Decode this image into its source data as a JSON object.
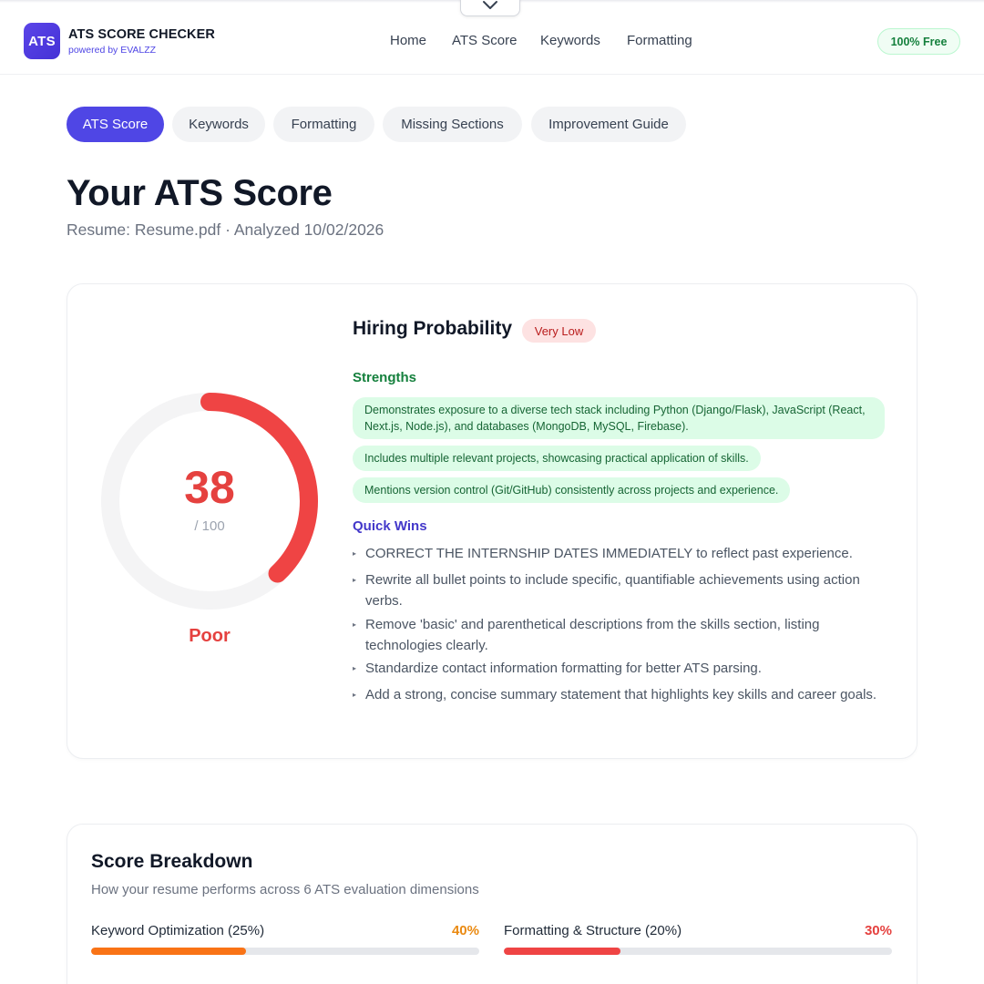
{
  "header": {
    "logo_text": "ATS",
    "brand_title": "ATS SCORE CHECKER",
    "brand_sub": "powered by EVALZZ",
    "nav": [
      "Home",
      "ATS Score",
      "Keywords",
      "Formatting"
    ],
    "badge": "100% Free"
  },
  "tabs": [
    "ATS Score",
    "Keywords",
    "Formatting",
    "Missing Sections",
    "Improvement Guide"
  ],
  "active_tab": "ATS Score",
  "page": {
    "title": "Your ATS Score",
    "subtitle": "Resume: Resume.pdf · Analyzed 10/02/2026"
  },
  "score": {
    "value": 38,
    "max_label": "/ 100",
    "max": 100,
    "rating": "Poor",
    "color": "#ef4444"
  },
  "hiring": {
    "title": "Hiring Probability",
    "badge": "Very Low"
  },
  "strengths": {
    "label": "Strengths",
    "items": [
      "Demonstrates exposure to a diverse tech stack including Python (Django/Flask), JavaScript (React, Next.js, Node.js), and databases (MongoDB, MySQL, Firebase).",
      "Includes multiple relevant projects, showcasing practical application of skills.",
      "Mentions version control (Git/GitHub) consistently across projects and experience."
    ]
  },
  "quick_wins": {
    "label": "Quick Wins",
    "items": [
      "CORRECT THE INTERNSHIP DATES IMMEDIATELY to reflect past experience.",
      "Rewrite all bullet points to include specific, quantifiable achievements using action verbs.",
      "Remove 'basic' and parenthetical descriptions from the skills section, listing technologies clearly.",
      "Standardize contact information formatting for better ATS parsing.",
      "Add a strong, concise summary statement that highlights key skills and career goals."
    ]
  },
  "breakdown": {
    "title": "Score Breakdown",
    "subtitle": "How your resume performs across 6 ATS evaluation dimensions",
    "metrics": [
      {
        "name": "Keyword Optimization (25%)",
        "value": "40%",
        "fraction": 0.4,
        "color": "#f97316"
      },
      {
        "name": "Formatting & Structure (20%)",
        "value": "30%",
        "fraction": 0.3,
        "color": "#ef4444"
      }
    ]
  },
  "colors": {
    "accent": "#4f46e5",
    "poor": "#ef4444",
    "success_bg": "#dcfce7",
    "success_text": "#166534"
  }
}
